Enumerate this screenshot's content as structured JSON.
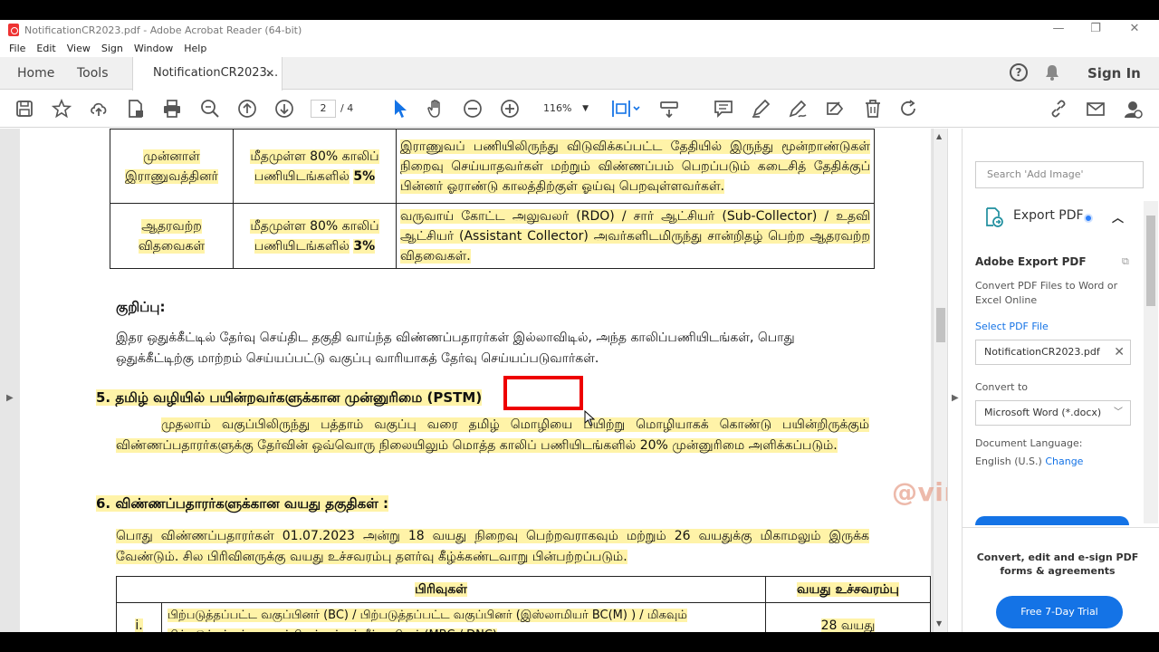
{
  "window": {
    "title": "NotificationCR2023.pdf - Adobe Acrobat Reader (64-bit)"
  },
  "menu": [
    "File",
    "Edit",
    "View",
    "Sign",
    "Window",
    "Help"
  ],
  "tabs": {
    "home": "Home",
    "tools": "Tools",
    "doc": "NotificationCR2023...",
    "sign_in": "Sign In"
  },
  "toolbar": {
    "page_current": "2",
    "page_total": "/ 4",
    "zoom": "116%"
  },
  "document": {
    "table1": [
      {
        "category": "முன்னாள் இராணுவத்தினர்",
        "percent_text": "மீதமுள்ள 80% காலிப் பணியிடங்களில்",
        "percent": "5%",
        "desc": "இராணுவப் பணியிலிருந்து விடுவிக்கப்பட்ட தேதியில் இருந்து மூன்றாண்டுகள் நிறைவு செய்யாதவர்கள் மற்றும் விண்ணப்பம் பெறப்படும் கடைசித் தேதிக்குப் பின்னர் ஓராண்டு காலத்திற்குள் ஓய்வு பெறவுள்ளவர்கள்."
      },
      {
        "category": "ஆதரவற்ற விதவைகள்",
        "percent_text": "மீதமுள்ள 80% காலிப் பணியிடங்களில்",
        "percent": "3%",
        "desc": "வருவாய் கோட்ட அலுவலர் (RDO) / சார் ஆட்சியர் (Sub-Collector) / உதவி ஆட்சியர் (Assistant Collector) அவர்களிடமிருந்து சான்றிதழ் பெற்ற ஆதரவற்ற விதவைகள்."
      }
    ],
    "note_heading": "குறிப்பு:",
    "note_text": "இதர ஒதுக்கீட்டில் தேர்வு செய்திட தகுதி வாய்ந்த விண்ணப்பதாரர்கள் இல்லாவிடில், அந்த காலிப்பணியிடங்கள், பொது ஒதுக்கீட்டிற்கு மாற்றம் செய்யப்பட்டு வகுப்பு வாரியாகத் தேர்வு செய்யப்படுவார்கள்.",
    "section5_heading": "5. தமிழ் வழியில் பயின்றவர்களுக்கான முன்னுரிமை (PSTM)",
    "section5_text": "முதலாம் வகுப்பிலிருந்து பத்தாம் வகுப்பு வரை தமிழ் மொழியை பயிற்று மொழியாகக் கொண்டு பயின்றிருக்கும் விண்ணப்பதாரர்களுக்கு தேர்வின் ஒவ்வொரு நிலையிலும் மொத்த காலிப் பணியிடங்களில் 20% முன்னுரிமை அளிக்கப்படும்.",
    "section6_heading": "6. விண்ணப்பதாரர்களுக்கான வயது தகுதிகள் :",
    "section6_text": "பொது விண்ணப்பதாரர்கள் 01.07.2023 அன்று 18 வயது நிறைவு பெற்றவராகவும் மற்றும் 26 வயதுக்கு மிகாமலும் இருக்க வேண்டும். சில பிரிவினருக்கு வயது உச்சவரம்பு தளர்வு கீழ்க்கண்டவாறு பின்பற்றப்படும்.",
    "table2_headers": [
      "பிரிவுகள்",
      "வயது உச்சவரம்பு"
    ],
    "table2_rows": [
      {
        "idx": "i.",
        "category": "பிற்படுத்தப்பட்ட வகுப்பினர் (BC) / பிற்படுத்தப்பட்ட வகுப்பினர் (இஸ்லாமியர் BC(M) ) / மிகவும் பிற்படுத்தப்பட்ட வகுப்பினர் மற்றும் சீர்மரபினர் (MBC / DNC)",
        "age": "28 வயது"
      }
    ],
    "watermark": "@vinobrowsing"
  },
  "right_panel": {
    "search_placeholder": "Search 'Add Image'",
    "export_label": "Export PDF",
    "heading": "Adobe Export PDF",
    "description": "Convert PDF Files to Word or Excel Online",
    "select_link": "Select PDF File",
    "file_name": "NotificationCR2023.pdf",
    "convert_to_label": "Convert to",
    "convert_to_value": "Microsoft Word (*.docx)",
    "doc_lang_label": "Document Language:",
    "doc_lang_value": "English (U.S.)",
    "change_link": "Change",
    "promo": "Convert, edit and e-sign PDF forms & agreements",
    "trial_button": "Free 7-Day Trial"
  },
  "colors": {
    "highlight": "#fff3a8",
    "accent": "#1473e6",
    "annotation": "#e00000"
  }
}
